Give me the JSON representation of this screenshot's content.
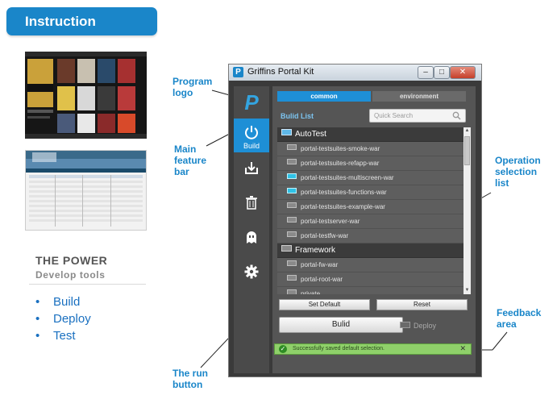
{
  "header": {
    "title": "Instruction"
  },
  "left": {
    "power_title": "THE POWER",
    "power_subtitle": "Develop tools",
    "bullets": [
      "Build",
      "Deploy",
      "Test"
    ]
  },
  "callouts": {
    "program_logo": [
      "Program",
      "logo"
    ],
    "main_feature_bar": [
      "Main",
      "feature",
      "bar"
    ],
    "operation_selection_list": [
      "Operation",
      "selection",
      "list"
    ],
    "feedback_area": [
      "Feedback",
      "area"
    ],
    "run_button": [
      "The run",
      "button"
    ]
  },
  "window": {
    "title": "Griffins Portal Kit",
    "controls": {
      "minimize": "–",
      "maximize": "□",
      "close": "✕"
    },
    "sidebar": {
      "logo": "P",
      "items": [
        {
          "name": "build",
          "label": "Build",
          "active": true,
          "icon": "power-icon"
        },
        {
          "name": "deploy",
          "label": "",
          "active": false,
          "icon": "download-icon"
        },
        {
          "name": "delete",
          "label": "",
          "active": false,
          "icon": "trash-icon"
        },
        {
          "name": "ghost",
          "label": "",
          "active": false,
          "icon": "ghost-icon"
        },
        {
          "name": "settings",
          "label": "",
          "active": false,
          "icon": "gear-icon"
        }
      ]
    },
    "tabs": [
      {
        "label": "common",
        "active": true
      },
      {
        "label": "environment",
        "active": false
      }
    ],
    "build_list_title": "Bulid List",
    "search": {
      "placeholder": "Quick Search"
    },
    "list": {
      "groups": [
        {
          "name": "AutoTest",
          "items": [
            {
              "label": "portal-testsuites-smoke-war",
              "checked": false
            },
            {
              "label": "portal-testsuites-refapp-war",
              "checked": false
            },
            {
              "label": "portal-testsuites-multiscreen-war",
              "checked": true
            },
            {
              "label": "portal-testsuites-functions-war",
              "checked": true
            },
            {
              "label": "portal-testsuites-example-war",
              "checked": false
            },
            {
              "label": "portal-testserver-war",
              "checked": false
            },
            {
              "label": "portal-testfw-war",
              "checked": false
            }
          ]
        },
        {
          "name": "Framework",
          "items": [
            {
              "label": "portal-fw-war",
              "checked": false
            },
            {
              "label": "portal-root-war",
              "checked": false
            },
            {
              "label": "private",
              "checked": false
            }
          ]
        }
      ]
    },
    "buttons": {
      "set_default": "Set Default",
      "reset": "Reset",
      "build": "Bulid",
      "deploy_option": "Deploy"
    },
    "feedback": {
      "message": "Successfully saved default selection.",
      "close": "✕"
    },
    "colors": {
      "accent": "#1e8fd6",
      "success": "#8fd06a",
      "panel": "#555555"
    }
  }
}
